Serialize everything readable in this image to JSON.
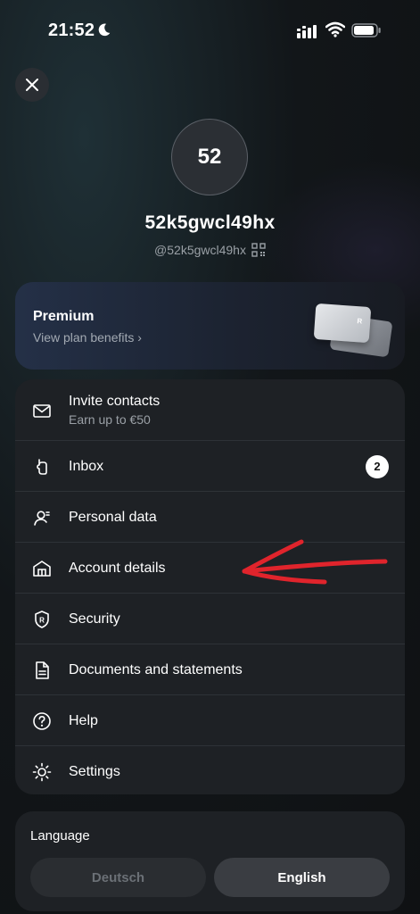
{
  "status_bar": {
    "time": "21:52"
  },
  "profile": {
    "avatar_initials": "52",
    "username": "52k5gwcl49hx",
    "handle": "@52k5gwcl49hx"
  },
  "premium": {
    "title": "Premium",
    "subtitle": "View plan benefits ›",
    "card_mark": "R"
  },
  "menu": {
    "items": [
      {
        "label": "Invite contacts",
        "sublabel": "Earn up to €50",
        "icon": "mail-icon"
      },
      {
        "label": "Inbox",
        "badge": "2",
        "icon": "inbox-icon"
      },
      {
        "label": "Personal data",
        "icon": "person-icon"
      },
      {
        "label": "Account details",
        "icon": "bank-icon"
      },
      {
        "label": "Security",
        "icon": "shield-icon"
      },
      {
        "label": "Documents and statements",
        "icon": "document-icon"
      },
      {
        "label": "Help",
        "icon": "help-icon"
      },
      {
        "label": "Settings",
        "icon": "gear-icon"
      }
    ]
  },
  "language": {
    "title": "Language",
    "options": [
      "Deutsch",
      "English"
    ],
    "selected": "English"
  },
  "colors": {
    "background": "#121619",
    "card": "#1e2125",
    "annotation_red": "#e0242c"
  }
}
